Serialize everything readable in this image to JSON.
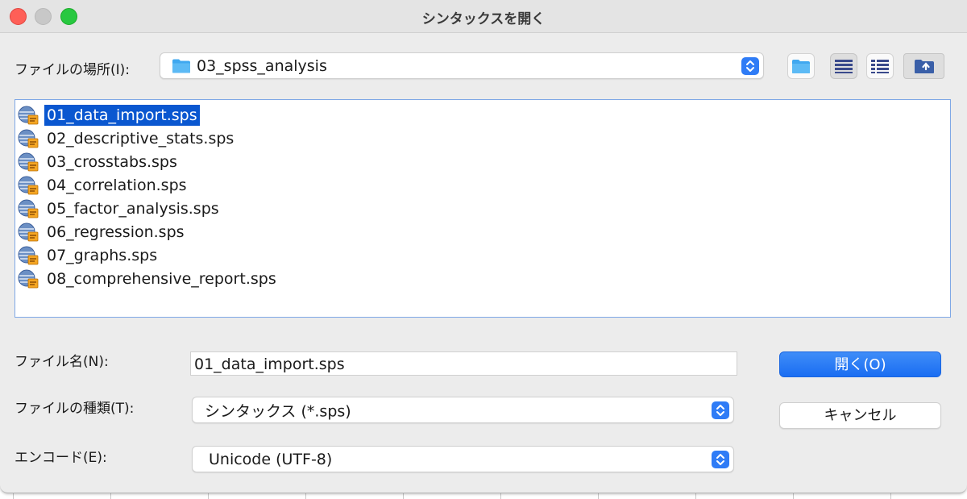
{
  "window": {
    "title": "シンタックスを開く"
  },
  "location": {
    "label": "ファイルの場所(I):",
    "value": "03_spss_analysis"
  },
  "toolbar": {
    "icons": [
      "new-folder-icon",
      "list-view-icon",
      "details-view-icon",
      "up-folder-icon"
    ]
  },
  "files": [
    {
      "name": "01_data_import.sps",
      "selected": true
    },
    {
      "name": "02_descriptive_stats.sps",
      "selected": false
    },
    {
      "name": "03_crosstabs.sps",
      "selected": false
    },
    {
      "name": "04_correlation.sps",
      "selected": false
    },
    {
      "name": "05_factor_analysis.sps",
      "selected": false
    },
    {
      "name": "06_regression.sps",
      "selected": false
    },
    {
      "name": "07_graphs.sps",
      "selected": false
    },
    {
      "name": "08_comprehensive_report.sps",
      "selected": false
    }
  ],
  "filename": {
    "label": "ファイル名(N):",
    "value": "01_data_import.sps"
  },
  "filetype": {
    "label": "ファイルの種類(T):",
    "value": "シンタックス (*.sps)"
  },
  "encoding": {
    "label": "エンコード(E):",
    "value": "Unicode (UTF-8)"
  },
  "buttons": {
    "open": "開く(O)",
    "cancel": "キャンセル"
  },
  "colors": {
    "accent": "#1a6df2",
    "selection": "#0a57d0"
  }
}
